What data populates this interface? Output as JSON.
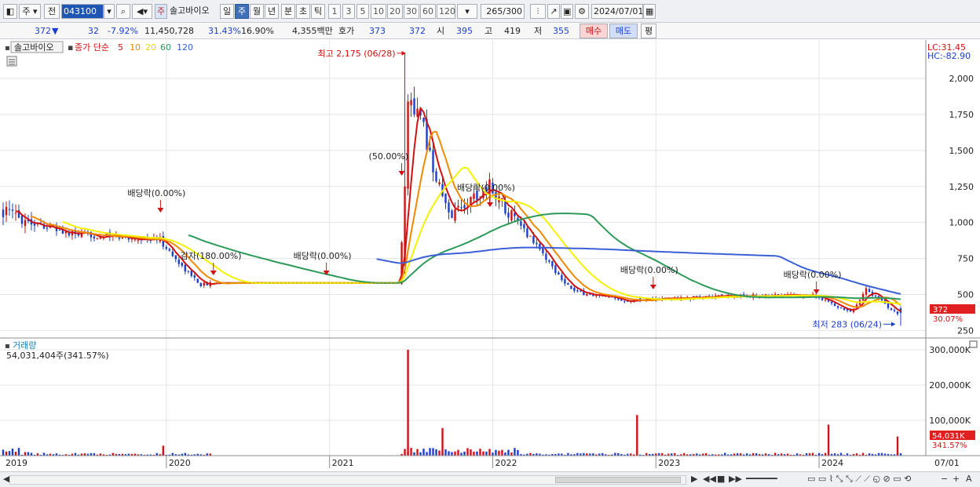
{
  "toolbar": {
    "type_select": "주",
    "period_label": "전",
    "code": "043100",
    "stock_badge": "주",
    "stock_name": "솔고바이오",
    "period_tabs": [
      {
        "label": "일",
        "active": false
      },
      {
        "label": "주",
        "active": true
      },
      {
        "label": "월",
        "active": false
      },
      {
        "label": "년",
        "active": false
      },
      {
        "label": "분",
        "active": false
      },
      {
        "label": "초",
        "active": false
      },
      {
        "label": "틱",
        "active": false
      }
    ],
    "interval_tabs": [
      "1",
      "3",
      "5",
      "10",
      "20",
      "30",
      "60",
      "120"
    ],
    "count": "265",
    "count_max": "/300",
    "date": "2024/07/01"
  },
  "quote": {
    "price": "372",
    "change_arrow": "▼",
    "change": "32",
    "change_pct": "-7.92%",
    "volume": "11,450,728",
    "vol_ratio": "31.43%",
    "turnover": "16.90%",
    "amount": "4,355백만",
    "ask_label": "호가",
    "ask1": "373",
    "ask2": "372",
    "open_label": "시",
    "open": "395",
    "high_label": "고",
    "high": "419",
    "low_label": "저",
    "low": "355",
    "buy_button": "매수",
    "sell_button": "매도",
    "eval_button": "평"
  },
  "colors": {
    "up": "#d01212",
    "down": "#1a3fcf",
    "ma5": "#d01212",
    "ma10": "#f08a00",
    "ma20": "#f2f200",
    "ma60": "#2e9a5a",
    "ma120": "#3a5fd6"
  },
  "chart_data": {
    "type": "candlestick",
    "price_panel": {
      "legend_name": "솔고바이오",
      "legend_ma_label": "종가 단순",
      "ma_periods": [
        "5",
        "10",
        "20",
        "60",
        "120"
      ],
      "y_ticks": [
        250,
        500,
        750,
        1000,
        1250,
        1500,
        1750,
        2000
      ],
      "y_tick_labels": [
        "250",
        "500",
        "750",
        "1,000",
        "1,250",
        "1,500",
        "1,750",
        "2,000"
      ],
      "ylim": [
        220,
        2250
      ],
      "lc_label": "LC:31.45",
      "hc_label": "HC:-82.90",
      "last_price_label": "372",
      "last_pct_label": "30.07%",
      "annotations": [
        {
          "text": "최고 2,175 (06/28)",
          "date": "2021/06/28",
          "price": 2175
        },
        {
          "text": "최저 283 (06/24)",
          "date": "2024/06/24",
          "price": 283
        },
        {
          "text": "배당락(0.00%)",
          "date": "2019/12/24"
        },
        {
          "text": "감자(180.00%)",
          "date": "2020/04/20"
        },
        {
          "text": "배당락(0.00%)",
          "date": "2020/12/28"
        },
        {
          "text": "(50.00%)",
          "date": "2021/06/14"
        },
        {
          "text": "배당락(0.00%)",
          "date": "2021/12/28"
        },
        {
          "text": "배당락(0.00%)",
          "date": "2022/12/27"
        },
        {
          "text": "배당락(0.00%)",
          "date": "2023/12/26"
        }
      ],
      "key_points": [
        {
          "date": "2019/01/07",
          "close": 1080
        },
        {
          "date": "2019/06/03",
          "close": 920
        },
        {
          "date": "2019/12/23",
          "close": 880
        },
        {
          "date": "2020/03/23",
          "close": 570
        },
        {
          "date": "2021/06/07",
          "close": 600
        },
        {
          "date": "2021/06/28",
          "close": 1900
        },
        {
          "date": "2021/08/02",
          "close": 1650
        },
        {
          "date": "2021/09/27",
          "close": 1050
        },
        {
          "date": "2021/12/27",
          "close": 1260
        },
        {
          "date": "2022/04/11",
          "close": 850
        },
        {
          "date": "2022/07/04",
          "close": 520
        },
        {
          "date": "2022/10/17",
          "close": 460
        },
        {
          "date": "2023/06/05",
          "close": 485
        },
        {
          "date": "2023/12/18",
          "close": 500
        },
        {
          "date": "2024/03/11",
          "close": 380
        },
        {
          "date": "2024/04/15",
          "close": 540
        },
        {
          "date": "2024/06/24",
          "close": 372
        }
      ]
    },
    "volume_panel": {
      "title": "거래량",
      "current_label": "54,031,404주(341.57%)",
      "y_ticks": [
        100000,
        200000,
        300000
      ],
      "y_tick_labels": [
        "100,000K",
        "200,000K",
        "300,000K"
      ],
      "ylim": [
        0,
        320000
      ],
      "last_value_label": "54,031K",
      "last_pct_label": "341.57%",
      "spikes": [
        {
          "date": "2019/12/30",
          "value_k": 28000
        },
        {
          "date": "2021/06/28",
          "value_k": 300000
        },
        {
          "date": "2021/09/13",
          "value_k": 78000
        },
        {
          "date": "2022/11/21",
          "value_k": 115000
        },
        {
          "date": "2024/01/22",
          "value_k": 88000
        },
        {
          "date": "2024/06/24",
          "value_k": 54031
        }
      ]
    },
    "x_axis": {
      "labels": [
        "2019",
        "2020",
        "2021",
        "2022",
        "2023",
        "2024",
        "07/01"
      ]
    }
  }
}
